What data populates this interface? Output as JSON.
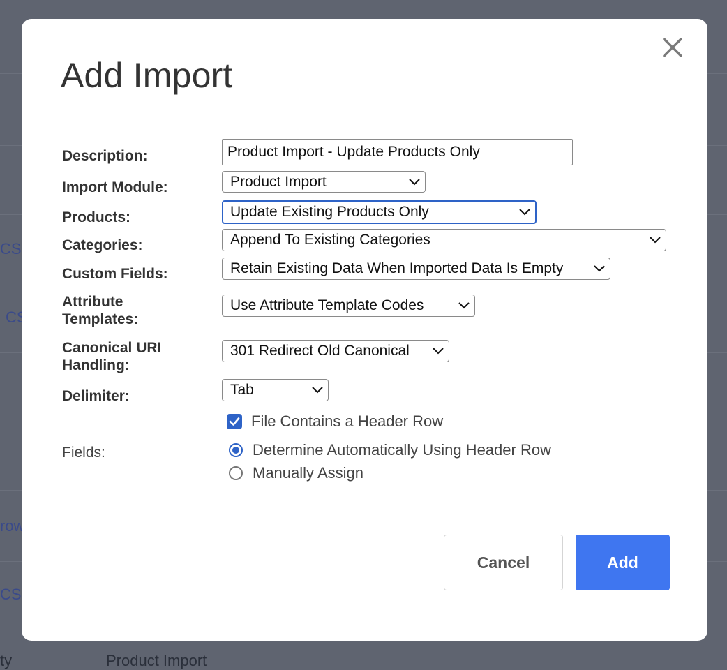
{
  "background": {
    "fragments": [
      "CS",
      "CS",
      "row",
      "CS"
    ],
    "bottom_left": "ty",
    "bottom_text": "Product Import"
  },
  "modal": {
    "title": "Add Import",
    "close_icon": "close-icon",
    "fields": {
      "description": {
        "label": "Description:",
        "value": "Product Import - Update Products Only"
      },
      "import_module": {
        "label": "Import Module:",
        "value": "Product Import"
      },
      "products": {
        "label": "Products:",
        "value": "Update Existing Products Only"
      },
      "categories": {
        "label": "Categories:",
        "value": "Append To Existing Categories"
      },
      "custom_fields": {
        "label": "Custom Fields:",
        "value": "Retain Existing Data When Imported Data Is Empty"
      },
      "attribute_templates": {
        "label_line1": "Attribute",
        "label_line2": "Templates:",
        "value": "Use Attribute Template Codes"
      },
      "canonical_uri": {
        "label_line1": "Canonical URI",
        "label_line2": "Handling:",
        "value": "301 Redirect Old Canonical"
      },
      "delimiter": {
        "label": "Delimiter:",
        "value": "Tab"
      }
    },
    "header_row": {
      "label": "File Contains a Header Row",
      "checked": true
    },
    "fields_section": {
      "label": "Fields:",
      "options": [
        {
          "label": "Determine Automatically Using Header Row",
          "selected": true
        },
        {
          "label": "Manually Assign",
          "selected": false
        }
      ]
    },
    "buttons": {
      "cancel": "Cancel",
      "add": "Add"
    },
    "colors": {
      "accent": "#2e63c7",
      "primary_button": "#3f76f0",
      "overlay": "#5f6470"
    }
  }
}
